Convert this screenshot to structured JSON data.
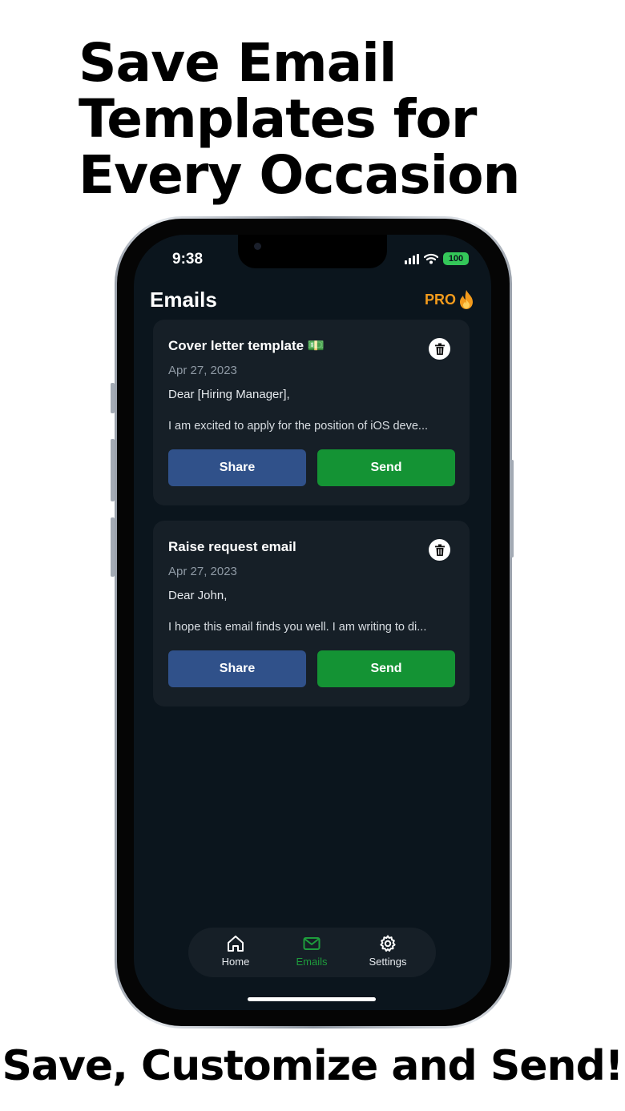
{
  "marketing": {
    "headline_lines": [
      "Save Email",
      "Templates for",
      "Every Occasion"
    ],
    "footer": "Save, Customize and Send!"
  },
  "status_bar": {
    "time": "9:38",
    "battery": "100"
  },
  "header": {
    "title": "Emails",
    "pro_label": "PRO"
  },
  "emails": [
    {
      "title": "Cover letter template 💵",
      "date": "Apr 27, 2023",
      "greeting": "Dear [Hiring Manager],",
      "preview": "I am excited to apply for the position of iOS deve...",
      "share_label": "Share",
      "send_label": "Send"
    },
    {
      "title": "Raise request email",
      "date": "Apr 27, 2023",
      "greeting": "Dear John,",
      "preview": "I hope this email finds you well. I am writing to di...",
      "share_label": "Share",
      "send_label": "Send"
    }
  ],
  "tabbar": {
    "items": [
      {
        "label": "Home",
        "icon": "home-icon"
      },
      {
        "label": "Emails",
        "icon": "mail-icon",
        "active": true
      },
      {
        "label": "Settings",
        "icon": "gear-icon"
      }
    ]
  },
  "colors": {
    "background": "#0b151d",
    "card": "#161f27",
    "share": "#30518a",
    "send": "#149334",
    "pro": "#f39b1c",
    "active_tab": "#1e9c3c"
  }
}
